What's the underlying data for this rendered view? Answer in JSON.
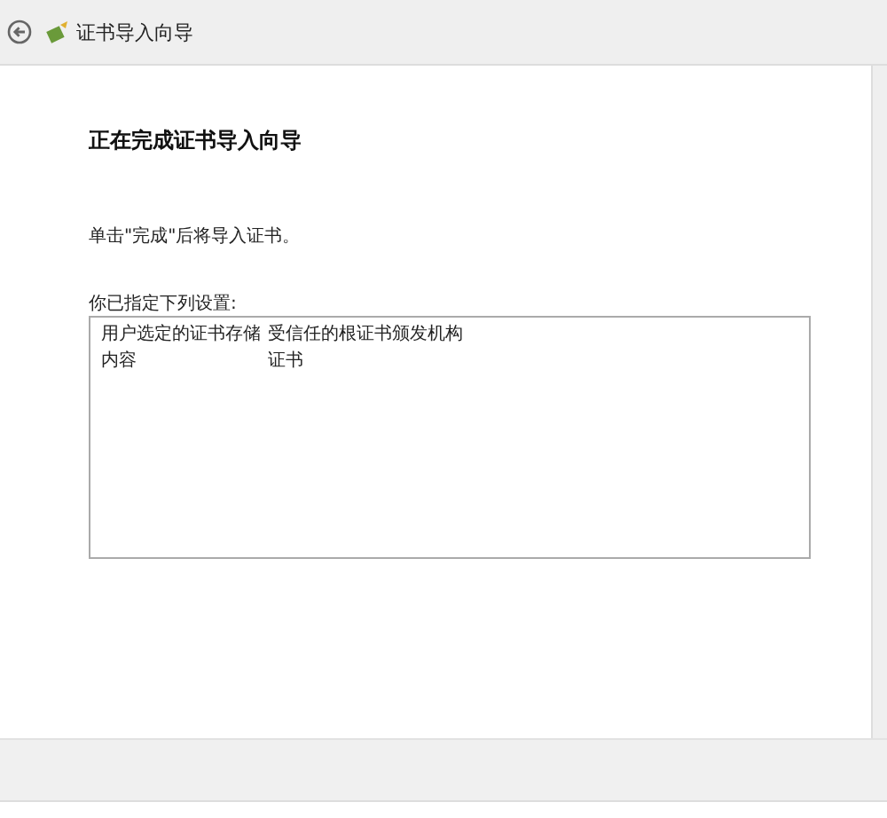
{
  "window": {
    "title": "证书导入向导"
  },
  "heading": "正在完成证书导入向导",
  "instruction": "单击\"完成\"后将导入证书。",
  "settings_label": "你已指定下列设置:",
  "settings": [
    {
      "name": "用户选定的证书存储",
      "value": "受信任的根证书颁发机构"
    },
    {
      "name": "内容",
      "value": "证书"
    }
  ]
}
